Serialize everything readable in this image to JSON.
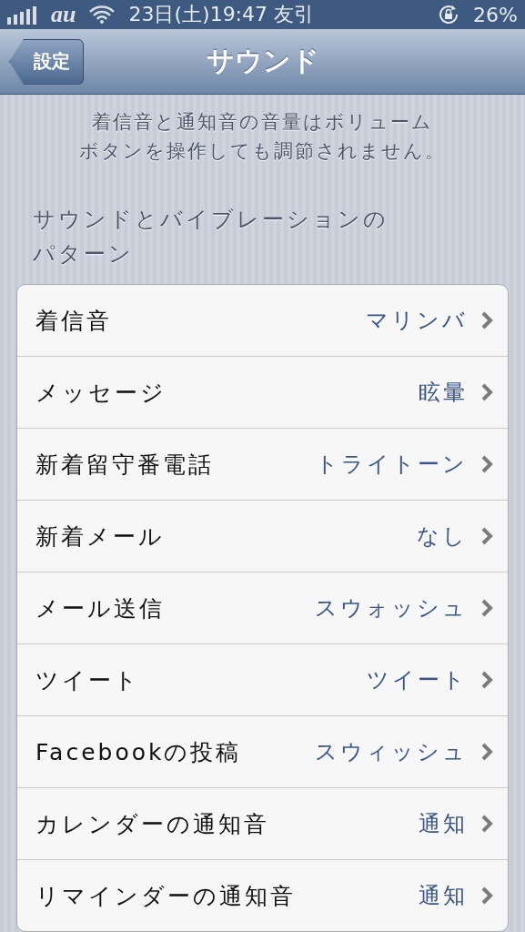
{
  "status_bar": {
    "carrier": "au",
    "time": "23日(土)19:47 友引",
    "battery": "26%"
  },
  "nav": {
    "back": "設定",
    "title": "サウンド"
  },
  "note": [
    "着信音と通知音の音量はボリューム",
    "ボタンを操作しても調節されません。"
  ],
  "section_title": [
    "サウンドとバイブレーションの",
    "パターン"
  ],
  "rows": [
    {
      "label": "着信音",
      "value": "マリンバ"
    },
    {
      "label": "メッセージ",
      "value": "眩暈"
    },
    {
      "label": "新着留守番電話",
      "value": "トライトーン"
    },
    {
      "label": "新着メール",
      "value": "なし"
    },
    {
      "label": "メール送信",
      "value": "スウォッシュ"
    },
    {
      "label": "ツイート",
      "value": "ツイート"
    },
    {
      "label": "Facebookの投稿",
      "value": "スウィッシュ"
    },
    {
      "label": "カレンダーの通知音",
      "value": "通知"
    },
    {
      "label": "リマインダーの通知音",
      "value": "通知"
    }
  ]
}
